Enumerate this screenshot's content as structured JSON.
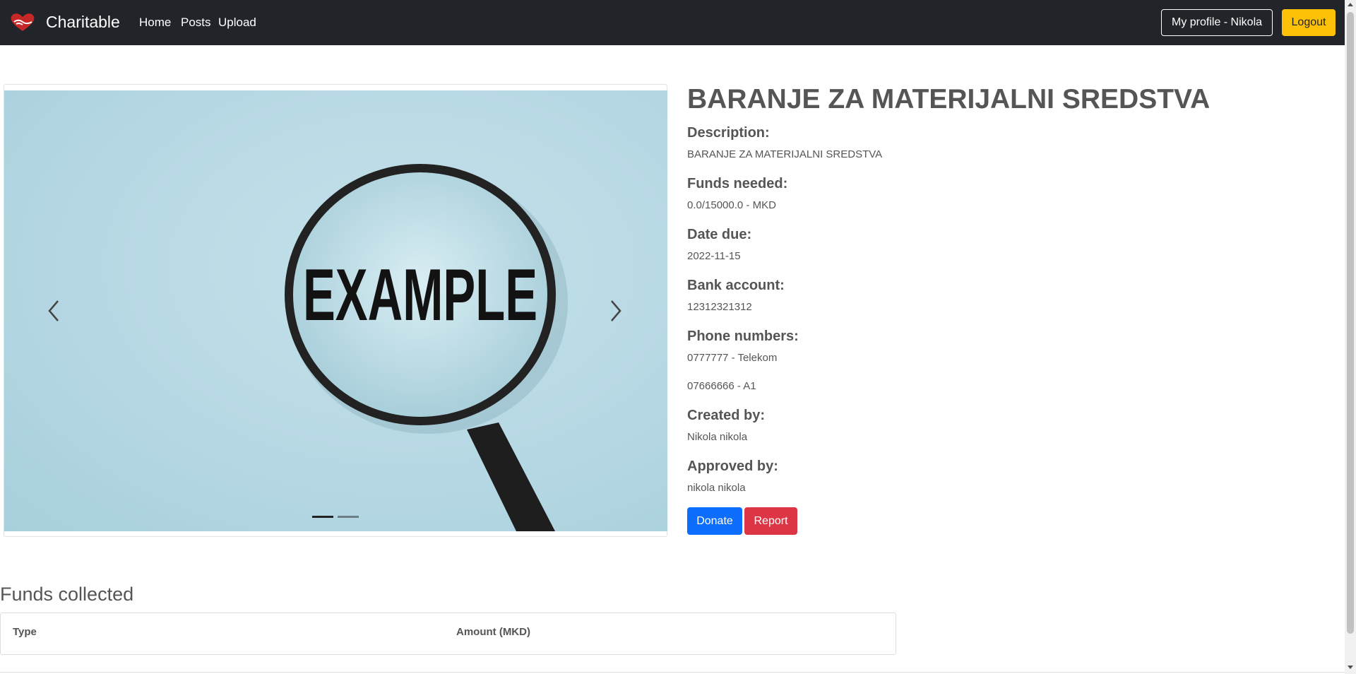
{
  "navbar": {
    "brand": "Charitable",
    "links": [
      "Home",
      "Posts",
      "Upload"
    ],
    "profile_button": "My profile - Nikola",
    "logout_button": "Logout"
  },
  "carousel": {
    "image_text": "EXAMPLE",
    "slides_count": 2,
    "active_slide": 1
  },
  "post": {
    "title": "BARANJE ZA MATERIJALNI SREDSTVA",
    "description_label": "Description:",
    "description": "BARANJE ZA MATERIJALNI SREDSTVA",
    "funds_label": "Funds needed:",
    "funds": "0.0/15000.0 - MKD",
    "date_label": "Date due:",
    "date": "2022-11-15",
    "bank_label": "Bank account:",
    "bank": "12312321312",
    "phones_label": "Phone numbers:",
    "phones": [
      "0777777 - Telekom",
      "07666666 - A1"
    ],
    "created_label": "Created by:",
    "created": "Nikola nikola",
    "approved_label": "Approved by:",
    "approved": "nikola nikola",
    "donate_button": "Donate",
    "report_button": "Report"
  },
  "funds_table": {
    "heading": "Funds collected",
    "columns": [
      "Type",
      "Amount (MKD)"
    ]
  },
  "colors": {
    "navbar_bg": "#212529",
    "logout_bg": "#ffc107",
    "donate_bg": "#0d6efd",
    "report_bg": "#dc3545"
  }
}
